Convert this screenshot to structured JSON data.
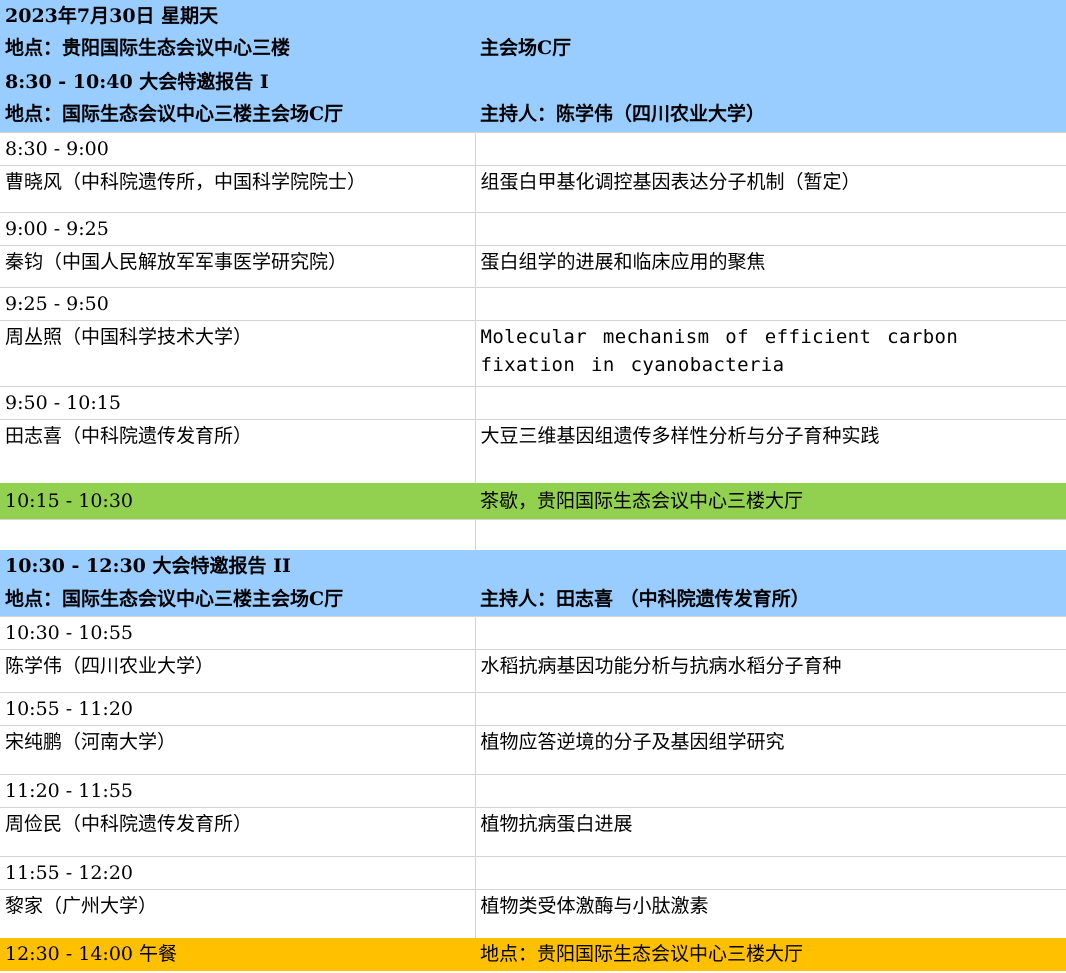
{
  "day_header": {
    "date": "2023年7月30日 星期天",
    "venue_left": "地点：贵阳国际生态会议中心三楼",
    "venue_right": "主会场C厅"
  },
  "session1": {
    "title": "8:30 - 10:40 大会特邀报告 I",
    "location": "地点：国际生态会议中心三楼主会场C厅",
    "host": "主持人：陈学伟（四川农业大学）",
    "talks": [
      {
        "time": "8:30 - 9:00",
        "speaker": "曹晓风（中科院遗传所，中国科学院院士）",
        "topic": "组蛋白甲基化调控基因表达分子机制（暂定）"
      },
      {
        "time": "9:00 - 9:25",
        "speaker": "秦钧（中国人民解放军军事医学研究院）",
        "topic": "蛋白组学的进展和临床应用的聚焦"
      },
      {
        "time": "9:25 - 9:50",
        "speaker": "周丛照（中国科学技术大学）",
        "topic": "Molecular mechanism of efficient carbon fixation in cyanobacteria"
      },
      {
        "time": "9:50 - 10:15",
        "speaker": "田志喜（中科院遗传发育所）",
        "topic": "大豆三维基因组遗传多样性分析与分子育种实践"
      }
    ]
  },
  "break": {
    "time": "10:15 - 10:30",
    "label": "茶歇，贵阳国际生态会议中心三楼大厅"
  },
  "session2": {
    "title": "10:30 - 12:30 大会特邀报告 II",
    "location": "地点：国际生态会议中心三楼主会场C厅",
    "host": "主持人：田志喜 （中科院遗传发育所）",
    "talks": [
      {
        "time": "10:30 - 10:55",
        "speaker": "陈学伟（四川农业大学）",
        "topic": "水稻抗病基因功能分析与抗病水稻分子育种"
      },
      {
        "time": "10:55 - 11:20",
        "speaker": "宋纯鹏（河南大学）",
        "topic": "植物应答逆境的分子及基因组学研究"
      },
      {
        "time": "11:20 - 11:55",
        "speaker": "周俭民（中科院遗传发育所）",
        "topic": "植物抗病蛋白进展"
      },
      {
        "time": "11:55 - 12:20",
        "speaker": "黎家（广州大学）",
        "topic": "植物类受体激酶与小肽激素"
      }
    ]
  },
  "lunch": {
    "label": "12:30 - 14:00 午餐",
    "location": "地点：贵阳国际生态会议中心三楼大厅"
  },
  "colors": {
    "header_blue": "#99ccff",
    "break_green": "#92d050",
    "lunch_orange": "#ffc000"
  }
}
